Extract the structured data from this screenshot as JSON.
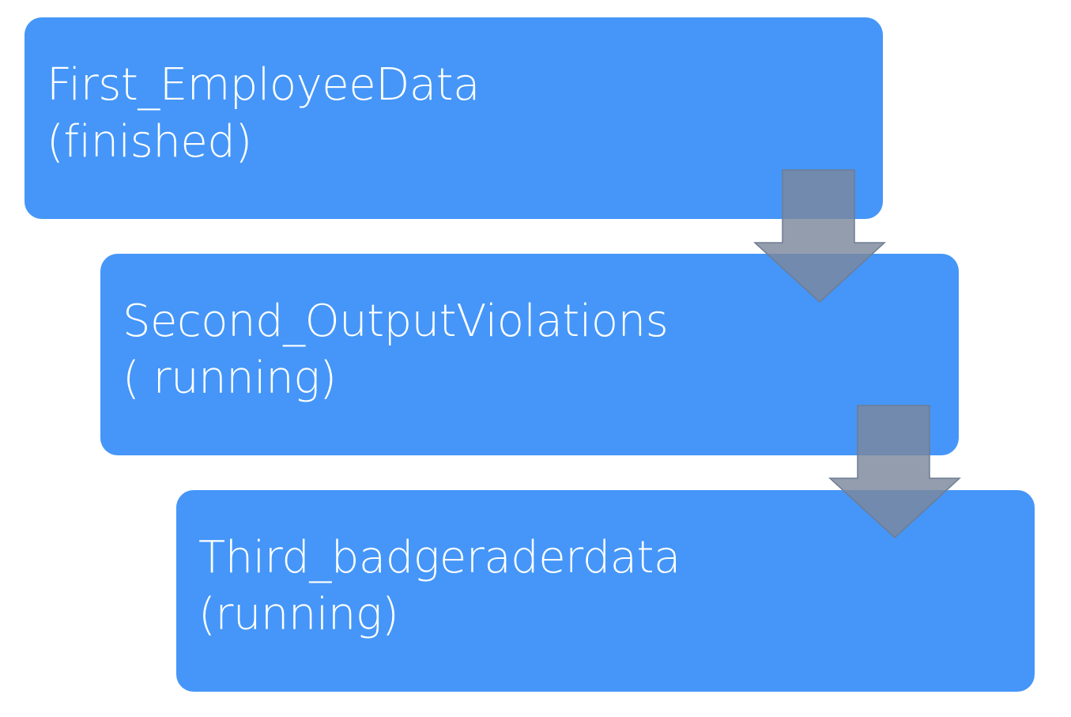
{
  "colors": {
    "box_fill": "#4596f8",
    "box_text": "#ffffff",
    "arrow_fill": "#7b889c",
    "arrow_stroke": "#6e7c92"
  },
  "steps": [
    {
      "name": "First_EmployeeData",
      "status": "(finished)"
    },
    {
      "name": "Second_OutputViolations",
      "status": "( running)"
    },
    {
      "name": "Third_badgeraderdata",
      "status": "(running)"
    }
  ],
  "connectors": [
    {
      "from": "First_EmployeeData",
      "to": "Second_OutputViolations",
      "icon": "down-arrow-icon"
    },
    {
      "from": "Second_OutputViolations",
      "to": "Third_badgeraderdata",
      "icon": "down-arrow-icon"
    }
  ]
}
